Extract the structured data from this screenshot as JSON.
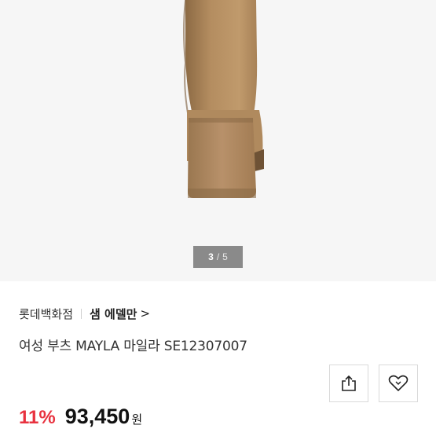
{
  "gallery": {
    "current_index": "3",
    "separator": "/",
    "total_count": "5",
    "image_subject": "suede boot heel"
  },
  "product": {
    "store_name": "롯데백화점",
    "brand_name": "샘 에델만",
    "brand_chevron": ">",
    "title": "여성 부츠 MAYLA 마일라 SE12307007",
    "discount_rate": "11%",
    "price": "93,450",
    "currency": "원"
  },
  "actions": {
    "share_icon": "share-icon",
    "wishlist_icon": "heart-icon"
  },
  "colors": {
    "discount": "#e8323f",
    "suede": "#b08a5e",
    "background": "#f6f6f6"
  }
}
